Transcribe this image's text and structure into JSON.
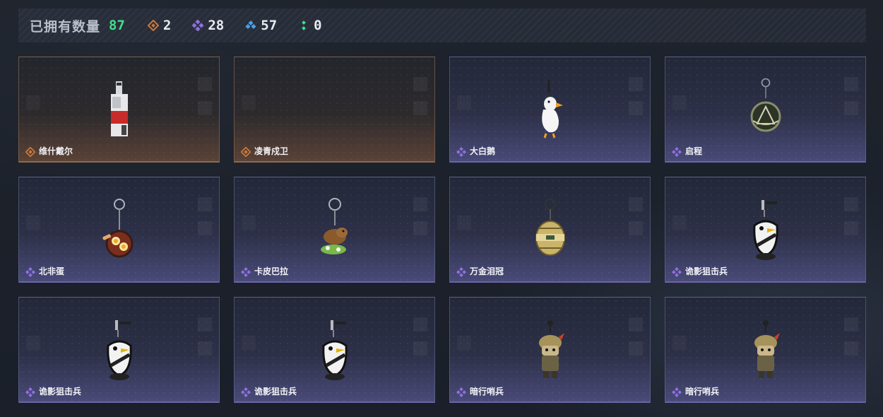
{
  "header": {
    "owned_label": "已拥有数量",
    "owned_count": "87",
    "rarities": [
      {
        "icon": "orange-diamond-icon",
        "count": "2",
        "color": "#c9773a"
      },
      {
        "icon": "purple-diamond-icon",
        "count": "28",
        "color": "#8f6fe0"
      },
      {
        "icon": "blue-diamond-icon",
        "count": "57",
        "color": "#4aa0e6"
      },
      {
        "icon": "green-dots-icon",
        "count": "0",
        "color": "#3ee08c"
      }
    ]
  },
  "items": [
    {
      "name": "维什戴尔",
      "rarity": "orange",
      "art": "tag-keychain-icon"
    },
    {
      "name": "凌青戍卫",
      "rarity": "orange",
      "art": ""
    },
    {
      "name": "大白鹅",
      "rarity": "purple",
      "art": "goose-keychain-icon"
    },
    {
      "name": "启程",
      "rarity": "purple",
      "art": "medal-keychain-icon"
    },
    {
      "name": "北非蛋",
      "rarity": "purple",
      "art": "pan-keychain-icon"
    },
    {
      "name": "卡皮巴拉",
      "rarity": "purple",
      "art": "capybara-keychain-icon"
    },
    {
      "name": "万金泪冠",
      "rarity": "purple",
      "art": "crown-keychain-icon"
    },
    {
      "name": "诡影狙击兵",
      "rarity": "purple",
      "art": "sniper-goose-keychain-icon"
    },
    {
      "name": "诡影狙击兵",
      "rarity": "purple",
      "art": "sniper-goose-keychain-icon"
    },
    {
      "name": "诡影狙击兵",
      "rarity": "purple",
      "art": "sniper-goose-keychain-icon"
    },
    {
      "name": "暗行哨兵",
      "rarity": "purple",
      "art": "soldier-keychain-icon"
    },
    {
      "name": "暗行哨兵",
      "rarity": "purple",
      "art": "soldier-keychain-icon"
    }
  ],
  "colors": {
    "orange_rarity": "#c9773a",
    "purple_rarity": "#8f6fe0",
    "owned_count": "#3ee08c"
  }
}
